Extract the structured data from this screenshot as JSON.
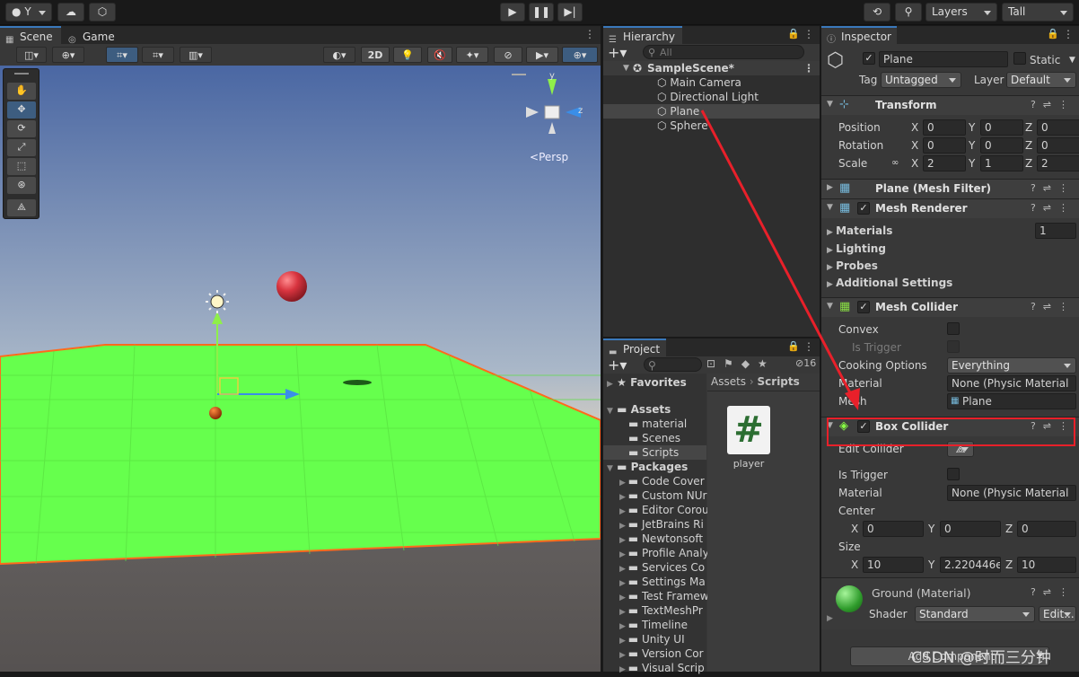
{
  "toolbar": {
    "account": "Y",
    "layers": "Layers",
    "layout": "Tall",
    "play_icon": "play-icon",
    "pause_icon": "pause-icon",
    "step_icon": "step-icon"
  },
  "scene": {
    "tabs": [
      "Scene",
      "Game"
    ],
    "btn_2d": "2D",
    "persp": "Persp",
    "gizmo_y": "y",
    "gizmo_z": "z"
  },
  "hierarchy": {
    "tab": "Hierarchy",
    "search_placeholder": "All",
    "scene_name": "SampleScene*",
    "items": [
      "Main Camera",
      "Directional Light",
      "Plane",
      "Sphere"
    ]
  },
  "project": {
    "tab": "Project",
    "count": "16",
    "favorites": "Favorites",
    "assets": "Assets",
    "asset_folders": [
      "material",
      "Scenes",
      "Scripts"
    ],
    "packages": "Packages",
    "package_folders": [
      "Code Cover",
      "Custom NUr",
      "Editor Corou",
      "JetBrains Ri",
      "Newtonsoft",
      "Profile Analy",
      "Services Co",
      "Settings Ma",
      "Test Framew",
      "TextMeshPr",
      "Timeline",
      "Unity UI",
      "Version Cor",
      "Visual Scrip"
    ],
    "breadcrumb": [
      "Assets",
      "Scripts"
    ],
    "file_name": "player",
    "file_glyph": "#"
  },
  "inspector": {
    "tab": "Inspector",
    "object_name": "Plane",
    "static_label": "Static",
    "tag_label": "Tag",
    "tag_value": "Untagged",
    "layer_label": "Layer",
    "layer_value": "Default",
    "transform": {
      "title": "Transform",
      "position_label": "Position",
      "rotation_label": "Rotation",
      "scale_label": "Scale",
      "position": [
        "0",
        "0",
        "0"
      ],
      "rotation": [
        "0",
        "0",
        "0"
      ],
      "scale": [
        "2",
        "1",
        "2"
      ],
      "axes": [
        "X",
        "Y",
        "Z"
      ]
    },
    "mesh_filter": {
      "title": "Plane (Mesh Filter)"
    },
    "mesh_renderer": {
      "title": "Mesh Renderer",
      "materials": "Materials",
      "materials_count": "1",
      "lighting": "Lighting",
      "probes": "Probes",
      "additional": "Additional Settings"
    },
    "mesh_collider": {
      "title": "Mesh Collider",
      "convex": "Convex",
      "is_trigger": "Is Trigger",
      "cooking": "Cooking Options",
      "cooking_value": "Everything",
      "material": "Material",
      "material_value": "None (Physic Material",
      "mesh": "Mesh",
      "mesh_value": "Plane"
    },
    "box_collider": {
      "title": "Box Collider",
      "edit_collider": "Edit Collider",
      "is_trigger": "Is Trigger",
      "material": "Material",
      "material_value": "None (Physic Material",
      "center": "Center",
      "center_values": [
        "0",
        "0",
        "0"
      ],
      "size": "Size",
      "size_values": [
        "10",
        "2.220446e",
        "10"
      ]
    },
    "material": {
      "name": "Ground (Material)",
      "shader_label": "Shader",
      "shader_value": "Standard",
      "edit": "Edit..."
    },
    "add_component": "Add Component"
  },
  "watermark": "CSDN @时而三分钟",
  "colors": {
    "accent": "#3a79bb",
    "ground": "#66ff4d",
    "outline": "#ff6a1c",
    "sphere": "#d8343f",
    "annotation": "#e8202a"
  }
}
